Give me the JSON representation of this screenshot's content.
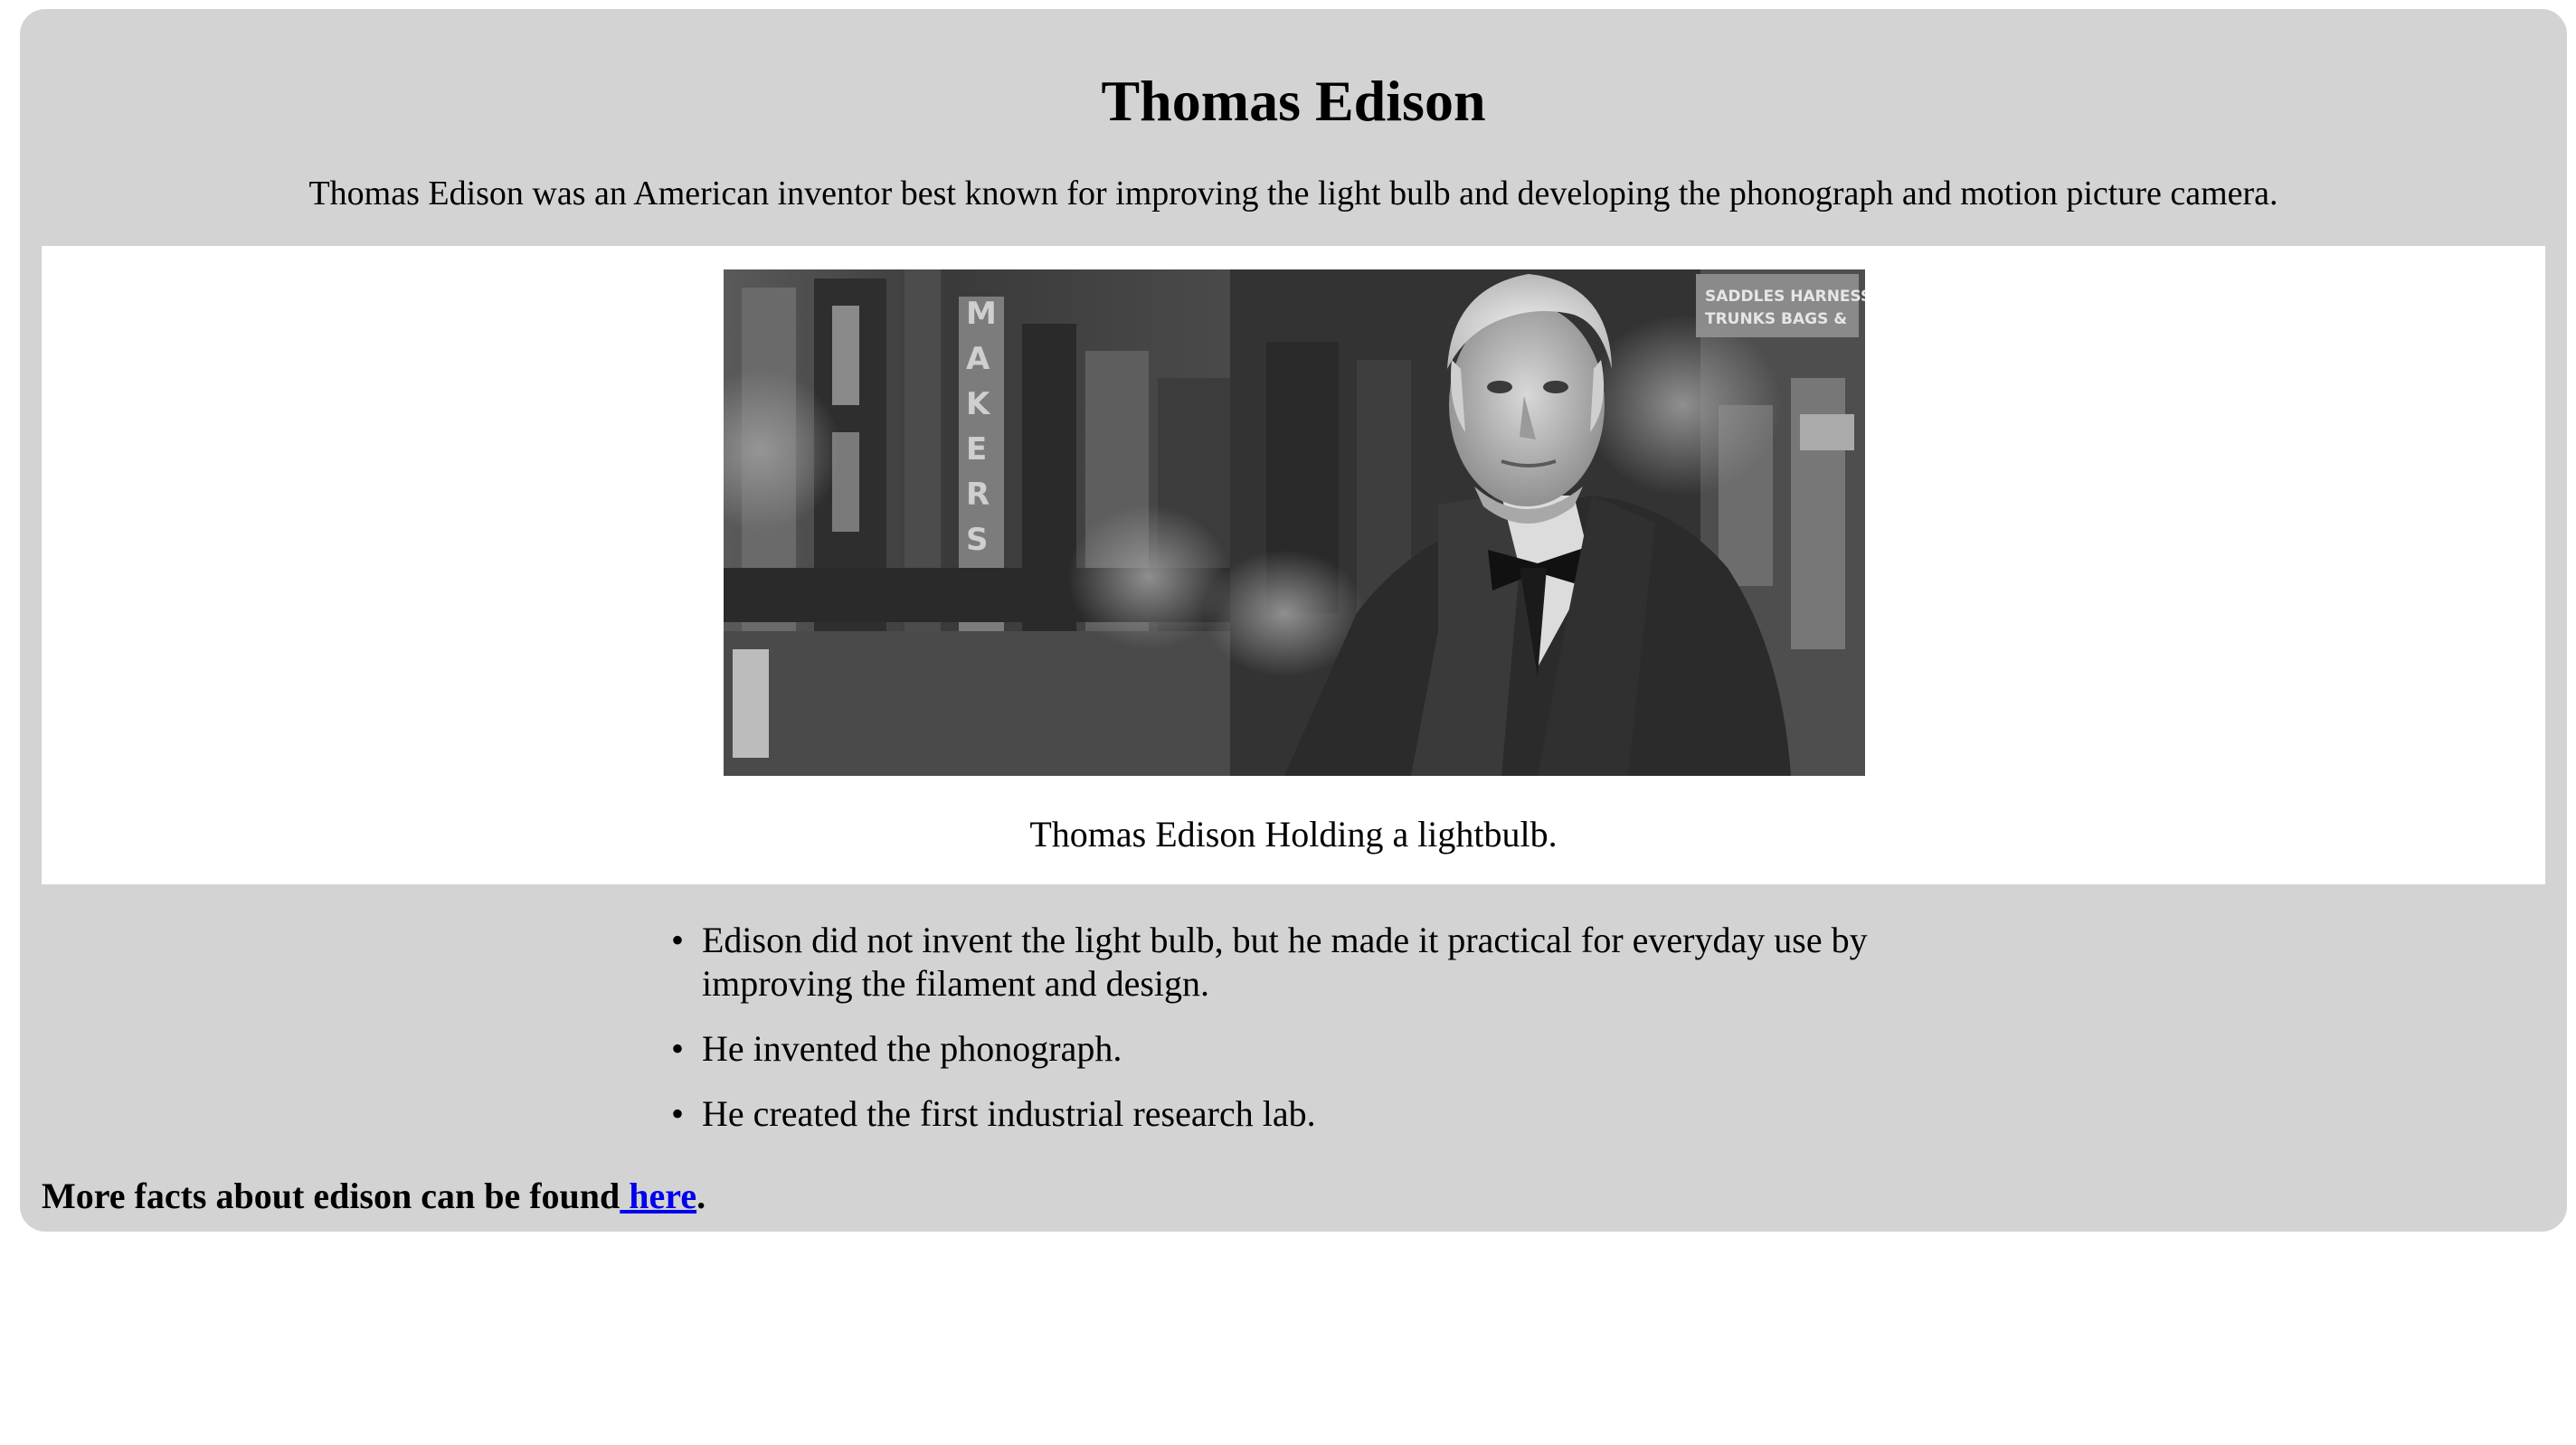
{
  "page": {
    "title": "Thomas Edison",
    "intro": "Thomas Edison was an American inventor best known for improving the light bulb and developing the phonograph and motion picture camera."
  },
  "figure": {
    "image_icon": "edison-portrait-photo",
    "caption": "Thomas Edison Holding a lightbulb.",
    "sign_text_1": "SADDLES HARNESS",
    "sign_text_2": "TRUNKS BAGS &",
    "sign_text_3": "SHOEMAKERS"
  },
  "facts": [
    "Edison did not invent the light bulb, but he made it practical for everyday use by improving the filament and design.",
    "He invented the phonograph.",
    "He created the first industrial research lab."
  ],
  "footer": {
    "prefix": "More facts about edison can be found",
    "link_text": " here",
    "suffix": "."
  },
  "colors": {
    "card_background": "#d3d3d3",
    "figure_background": "#ffffff",
    "link": "#0000ee"
  }
}
